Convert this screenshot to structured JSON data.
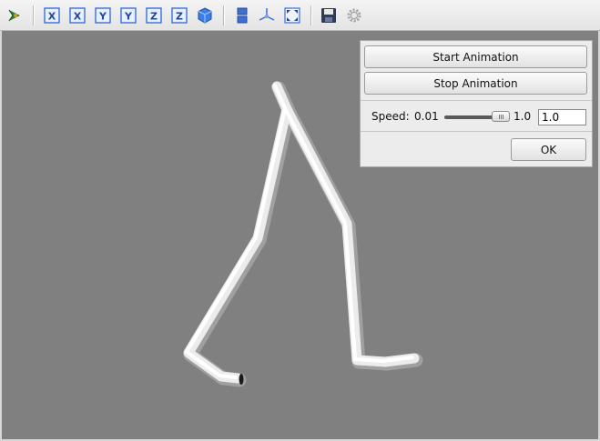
{
  "toolbar": {
    "icons": [
      "app-logo-icon",
      "view-x-icon",
      "view-x-reverse-icon",
      "view-y-icon",
      "view-y-reverse-icon",
      "view-z-icon",
      "view-z-reverse-icon",
      "view-iso-cube-icon",
      "split-view-icon",
      "axes-icon",
      "fit-all-icon",
      "save-icon",
      "settings-gear-icon"
    ],
    "axis_x": "X",
    "axis_y": "Y",
    "axis_z": "Z"
  },
  "panel": {
    "start_label": "Start Animation",
    "stop_label": "Stop Animation",
    "speed_label": "Speed:",
    "speed_min": "0.01",
    "speed_max": "1.0",
    "speed_value": "1.0",
    "speed_fraction": 1.0,
    "ok_label": "OK"
  },
  "colors": {
    "viewport_bg": "#808080",
    "accent": "#3a6fd8",
    "model": "#f0f0f0"
  }
}
